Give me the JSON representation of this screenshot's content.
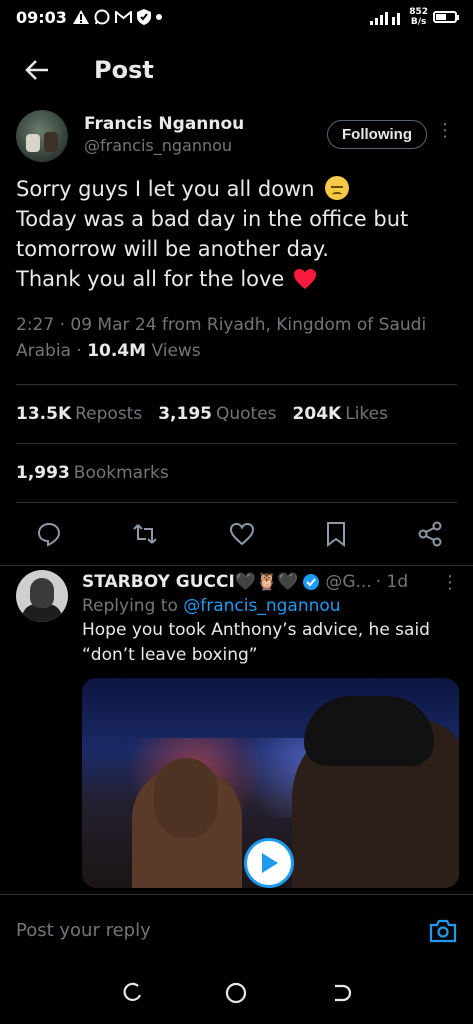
{
  "status_bar": {
    "time": "09:03",
    "net_speed_value": "852",
    "net_speed_unit": "B/s",
    "battery_level": 0.5
  },
  "header": {
    "title": "Post"
  },
  "post": {
    "author_name": "Francis Ngannou",
    "author_handle": "@francis_ngannou",
    "follow_label": "Following",
    "body_lines": [
      "Sorry guys I let you all down",
      "Today was a bad day in the office but",
      "tomorrow will be another day.",
      "Thank you all for the love"
    ],
    "meta_line1": "2:27 · 09 Mar 24 from Riyadh, Kingdom of Saudi",
    "meta_line2_prefix": "Arabia · ",
    "views_count": "10.4M",
    "views_label": " Views",
    "stats": {
      "reposts_count": "13.5K",
      "reposts_label": "Reposts",
      "quotes_count": "3,195",
      "quotes_label": "Quotes",
      "likes_count": "204K",
      "likes_label": "Likes",
      "bookmarks_count": "1,993",
      "bookmarks_label": "Bookmarks"
    }
  },
  "reply": {
    "name": "STARBOY GUCCI🖤🦉🖤",
    "handle": "@G...",
    "time": "· 1d",
    "replying_prefix": "Replying to ",
    "replying_handle": "@francis_ngannou",
    "text": "Hope you took Anthony’s advice, he said “don’t leave boxing”"
  },
  "reply_bar": {
    "placeholder": "Post your reply"
  },
  "colors": {
    "accent": "#1d9bf0",
    "background": "#000000",
    "text": "#e7e9ea",
    "muted": "#71767b",
    "heart": "#f91a3d"
  }
}
